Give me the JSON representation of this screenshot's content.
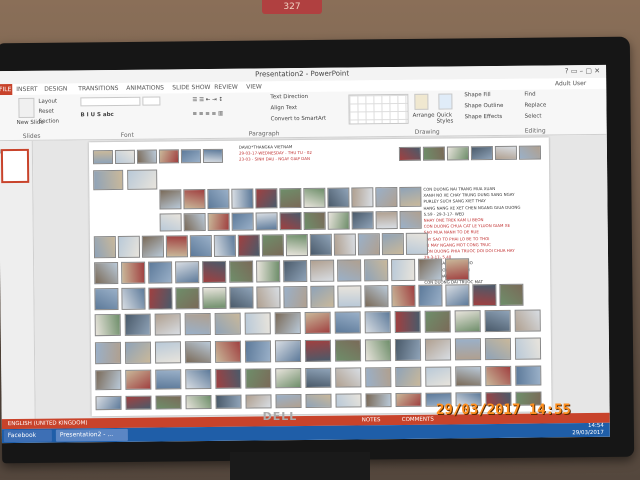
{
  "wall": {
    "plate_text": "327"
  },
  "window": {
    "title": "Presentation2 - PowerPoint",
    "controls": "?  ▭  –  ▢  ✕"
  },
  "ribbon_tabs": [
    {
      "label": "FILE"
    },
    {
      "label": "INSERT"
    },
    {
      "label": "DESIGN"
    },
    {
      "label": "TRANSITIONS"
    },
    {
      "label": "ANIMATIONS"
    },
    {
      "label": "SLIDE SHOW"
    },
    {
      "label": "REVIEW"
    },
    {
      "label": "VIEW"
    }
  ],
  "user": "Adult User",
  "ribbon": {
    "new_slide": "New Slide",
    "layout": "Layout",
    "reset": "Reset",
    "section": "Section",
    "text_direction": "Text Direction",
    "align_text": "Align Text",
    "convert_smartart": "Convert to SmartArt",
    "arrange": "Arrange",
    "quick_styles": "Quick Styles",
    "shape_fill": "Shape Fill",
    "shape_outline": "Shape Outline",
    "shape_effects": "Shape Effects",
    "find": "Find",
    "replace": "Replace",
    "select": "Select",
    "groups": {
      "slides": "Slides",
      "font": "Font",
      "paragraph": "Paragraph",
      "drawing": "Drawing",
      "editing": "Editing"
    }
  },
  "thumbnail": {
    "number": "1"
  },
  "slide": {
    "header_lines": [
      "DAVID*THANGKA VIETNAM",
      "29-03-17-WEDNESDAY - THU TU - 02",
      "23-03 - SINH DAU - NGAY GIAP DAN"
    ],
    "right_lines": [
      "CON DUONG NAI TRANG  MUA XUAN",
      "XANH NO XE CHAY TRUNG DUNG SANG NGAY",
      "PURLEY SUCH SANG XIET THAY",
      "HANG NANG XE XET CHEN NGANG GIUA DUONG",
      "5.59 - 29-3-17- WED",
      "NHAY ONE TREK KAM LI BEON",
      "CON DUONG CHUA CAT LE YLUON GIAM XE",
      "SAO MUA NANH  TO DE RUE",
      "SAY SAO TO PHAI LO BE TO THOI",
      "TU MAY NGANG MOT CONG TRUC",
      "CON DUONG PHIA TRUOC DOI DOI CHUA HAY",
      "29-3-17- 5.40",
      "THANG BA HOA DAO NO",
      "TULIP CUOI MUA XUAN",
      "BREXIT DAN KOI DAY",
      "CON DUONG DAI TRUOC MAT"
    ]
  },
  "status": {
    "language": "ENGLISH (UNITED KINGDOM)",
    "notes": "NOTES",
    "comments": "COMMENTS"
  },
  "taskbar": {
    "facebook": "Facebook",
    "powerpoint": "Presentation2 - ...",
    "clock_time": "14:54",
    "clock_date": "29/03/2017"
  },
  "camera_stamp": "29/03/2017  14:55",
  "monitor_brand": "DELL",
  "colors": {
    "accent": "#c8432b",
    "taskbar": "#1f5ea8",
    "stamp": "#ff9020"
  }
}
